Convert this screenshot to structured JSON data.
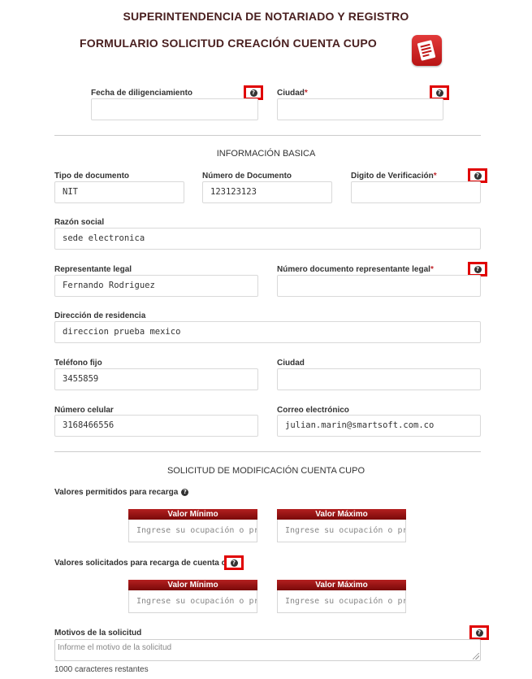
{
  "header": {
    "title": "SUPERINTENDENCIA DE NOTARIADO Y REGISTRO",
    "subtitle": "FORMULARIO SOLICITUD CREACIÓN CUENTA CUPO",
    "logo_icon": "document-list-icon",
    "accent_color": "#c0272d"
  },
  "top_fields": {
    "fecha_label": "Fecha de diligenciamiento",
    "fecha_value": "",
    "ciudad_label": "Ciudad",
    "ciudad_value": "",
    "required_mark": "*"
  },
  "info_basica": {
    "heading": "INFORMACIÓN BASICA",
    "tipo_documento_label": "Tipo de documento",
    "tipo_documento_value": "NIT",
    "numero_documento_label": "Número de Documento",
    "numero_documento_value": "123123123",
    "digito_label": "Digito de Verificación",
    "digito_value": "",
    "razon_social_label": "Razón social",
    "razon_social_value": "sede electronica",
    "representante_label": "Representante legal",
    "representante_value": "Fernando Rodriguez",
    "num_doc_rep_label": "Número documento representante legal",
    "num_doc_rep_value": "",
    "direccion_label": "Dirección de residencia",
    "direccion_value": "direccion prueba mexico",
    "telefono_label": "Teléfono fijo",
    "telefono_value": "3455859",
    "ciudad2_label": "Ciudad",
    "ciudad2_value": "",
    "celular_label": "Número celular",
    "celular_value": "3168466556",
    "correo_label": "Correo electrónico",
    "correo_value": "julian.marin@smartsoft.com.co"
  },
  "solicitud": {
    "heading": "SOLICITUD DE MODIFICACIÓN CUENTA CUPO",
    "permitidos_label": "Valores permitidos para recarga",
    "solicitados_label": "Valores solicitados para recarga de cuenta cupo",
    "valor_minimo_header": "Valor Mínimo",
    "valor_maximo_header": "Valor Máximo",
    "range_placeholder": "Ingrese su ocupación o profe",
    "motivos_label": "Motivos de la solicitud",
    "motivos_placeholder": "Informe el motivo de la solicitud",
    "chars_remaining": "1000 caracteres restantes"
  },
  "help_icon_glyph": "?"
}
